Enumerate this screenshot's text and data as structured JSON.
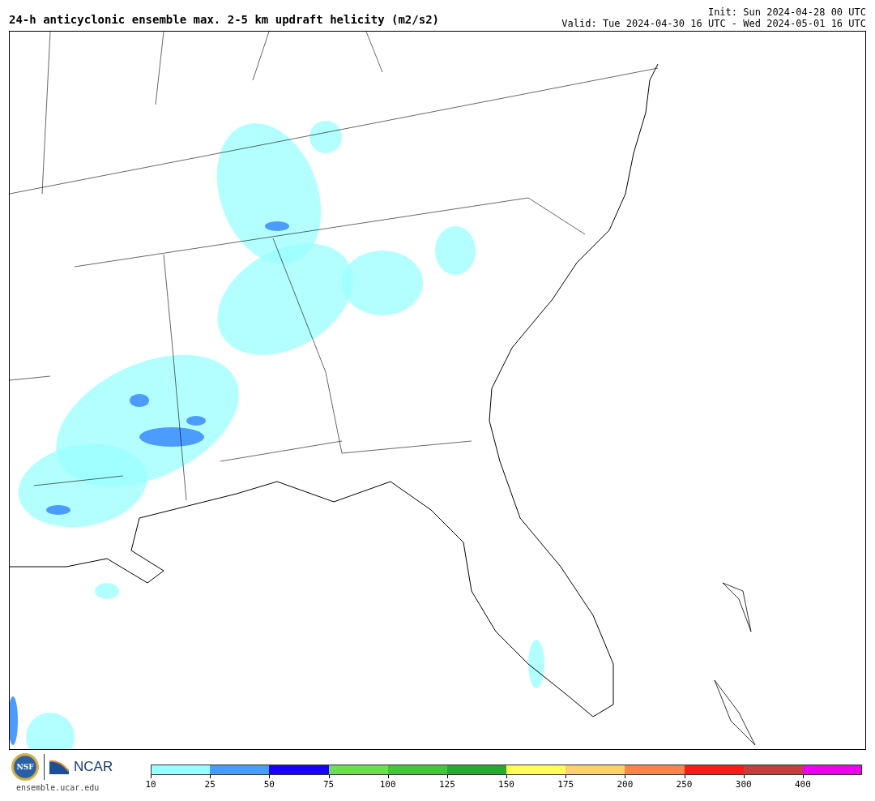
{
  "title": "24-h anticyclonic ensemble max. 2-5 km updraft helicity (m2/s2)",
  "init": "Init: Sun 2024-04-28 00 UTC",
  "valid": "Valid: Tue 2024-04-30 16 UTC - Wed 2024-05-01 16 UTC",
  "logos": {
    "nsf": "NSF",
    "ncar": "NCAR",
    "url": "ensemble.ucar.edu"
  },
  "colorbar": {
    "segments": [
      {
        "color": "#99ffff",
        "label": "10"
      },
      {
        "color": "#4c9cff",
        "label": "25"
      },
      {
        "color": "#1a00ff",
        "label": "50"
      },
      {
        "color": "#70dd50",
        "label": "75"
      },
      {
        "color": "#46c43f",
        "label": "100"
      },
      {
        "color": "#2aa632",
        "label": "125"
      },
      {
        "color": "#ffff55",
        "label": "150"
      },
      {
        "color": "#ffd070",
        "label": "175"
      },
      {
        "color": "#ff8250",
        "label": "200"
      },
      {
        "color": "#ff1a1a",
        "label": "250"
      },
      {
        "color": "#c83c3c",
        "label": "300"
      },
      {
        "color": "#ee00ee",
        "label": "400"
      }
    ]
  }
}
